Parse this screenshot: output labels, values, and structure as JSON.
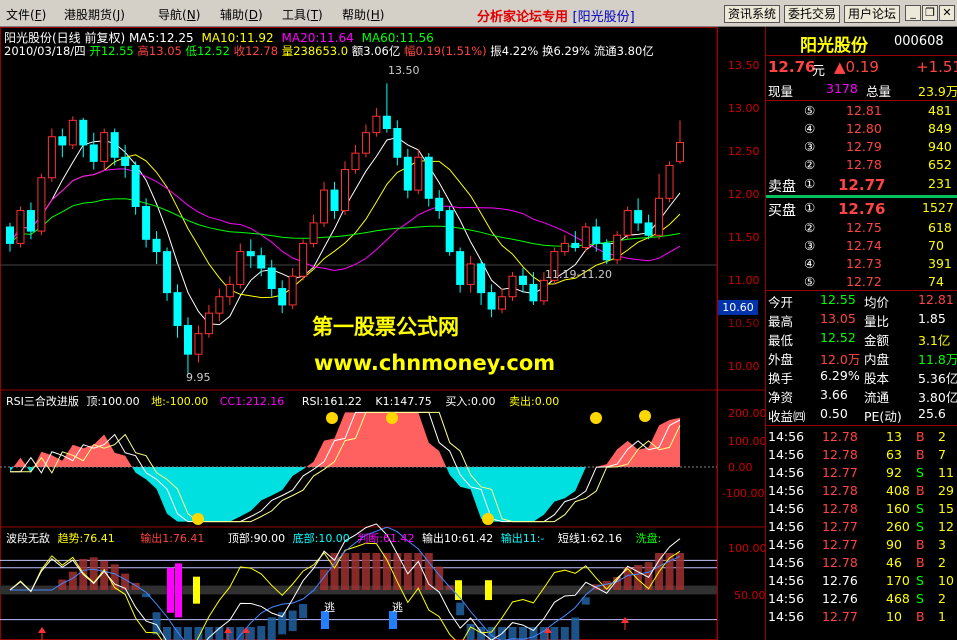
{
  "menubar": {
    "items": [
      {
        "label": "文件",
        "key": "F"
      },
      {
        "label": "港股期货",
        "key": "J"
      },
      {
        "label": "导航",
        "key": "N"
      },
      {
        "label": "辅助",
        "key": "D"
      },
      {
        "label": "工具",
        "key": "T"
      },
      {
        "label": "帮助",
        "key": "H"
      }
    ],
    "hint_prefix": "分析家论坛专用 ",
    "hint_stock": "[阳光股份]",
    "buttons": [
      "资讯系统",
      "委托交易",
      "用户论坛"
    ],
    "window_controls": [
      "_",
      "❐",
      "✕"
    ]
  },
  "kline": {
    "title_line1": [
      {
        "text": "阳光股份(日线 前复权)",
        "color": "#ffffff"
      },
      {
        "text": "MA5:12.25",
        "color": "#ffffff"
      },
      {
        "text": "MA10:11.92",
        "color": "#ffff00"
      },
      {
        "text": "MA20:11.64",
        "color": "#ff00ff"
      },
      {
        "text": "MA60:11.56",
        "color": "#00ff00"
      }
    ],
    "title_line2": [
      {
        "text": "2010/03/18/四",
        "color": "#ffffff"
      },
      {
        "text": "开12.55",
        "color": "#00ff00"
      },
      {
        "text": "高13.05",
        "color": "#ff4040"
      },
      {
        "text": "低12.52",
        "color": "#00ff00"
      },
      {
        "text": "收12.78",
        "color": "#ff4040"
      },
      {
        "text": "量238653.0",
        "color": "#ffff00"
      },
      {
        "text": "额3.06亿",
        "color": "#ffffff"
      },
      {
        "text": "幅0.19(1.51%)",
        "color": "#ff4040"
      },
      {
        "text": "振4.22%",
        "color": "#ffffff"
      },
      {
        "text": "换6.29%",
        "color": "#ffffff"
      },
      {
        "text": "流通3.80亿",
        "color": "#ffffff"
      }
    ],
    "y_axis": [
      "13.50",
      "13.00",
      "12.50",
      "12.00",
      "11.50",
      "11.00",
      "10.50",
      "10.00"
    ],
    "current_price_tag": "10.60",
    "annotations": {
      "high": "13.50",
      "low": "9.95",
      "range": "11.19-11.20"
    }
  },
  "watermark": {
    "line1": "第一股票公式网",
    "line2": "www.chnmoney.com"
  },
  "rsi": {
    "title": [
      {
        "text": "RSI三合改进版",
        "color": "#ffffff"
      },
      {
        "text": "顶:100.00",
        "color": "#ffffff"
      },
      {
        "text": "地:-100.00",
        "color": "#ffff00"
      },
      {
        "text": "CC1:212.16",
        "color": "#ff00ff"
      },
      {
        "text": "RSI:161.22",
        "color": "#ffffff"
      },
      {
        "text": "K1:147.75",
        "color": "#ffffff"
      },
      {
        "text": "买入:0.00",
        "color": "#ffffff"
      },
      {
        "text": "卖出:0.00",
        "color": "#ffff00"
      }
    ],
    "y_axis": [
      "200.00",
      "100.00",
      "0.00",
      "-100.00"
    ]
  },
  "wave": {
    "title": [
      {
        "text": "波段无敌",
        "color": "#ffffff"
      },
      {
        "text": "趋势:76.41",
        "color": "#ffff00"
      },
      {
        "text": "输出1:76.41",
        "color": "#ff4040"
      },
      {
        "text": "顶部:90.00",
        "color": "#ffffff"
      },
      {
        "text": "底部:10.00",
        "color": "#00ffff"
      },
      {
        "text": "判断:61.42",
        "color": "#ff00ff"
      },
      {
        "text": "输出10:61.42",
        "color": "#ffffff"
      },
      {
        "text": "输出11:-",
        "color": "#00ffff"
      },
      {
        "text": "短线1:62.16",
        "color": "#ffffff"
      },
      {
        "text": "洗盘:",
        "color": "#00ff00"
      }
    ],
    "y_axis": [
      "100.00",
      "50.00"
    ],
    "escape_label": "逃"
  },
  "side": {
    "name": "阳光股份",
    "code": "000608",
    "price": "12.76",
    "price_unit": "元",
    "change": "▲0.19",
    "pct": "+1.51",
    "xianliang_label": "现量",
    "xianliang": "3178",
    "zongliang_label": "总量",
    "zongliang": "23.9万",
    "asks": [
      [
        "⑤",
        "12.81",
        "481"
      ],
      [
        "④",
        "12.80",
        "849"
      ],
      [
        "③",
        "12.79",
        "940"
      ],
      [
        "②",
        "12.78",
        "652"
      ]
    ],
    "ask1": [
      "卖盘",
      "①",
      "12.77",
      "231"
    ],
    "bid1": [
      "买盘",
      "①",
      "12.76",
      "1527"
    ],
    "bids": [
      [
        "②",
        "12.75",
        "618"
      ],
      [
        "③",
        "12.74",
        "70"
      ],
      [
        "④",
        "12.73",
        "391"
      ],
      [
        "⑤",
        "12.72",
        "74"
      ]
    ],
    "stats": [
      [
        "今开",
        "12.55",
        "均价",
        "12.81"
      ],
      [
        "最高",
        "13.05",
        "量比",
        "1.85"
      ],
      [
        "最低",
        "12.52",
        "金额",
        "3.1亿"
      ],
      [
        "外盘",
        "12.0万",
        "内盘",
        "11.8万"
      ],
      [
        "换手",
        "6.29%",
        "股本",
        "5.36亿"
      ],
      [
        "净资",
        "3.66",
        "流通",
        "3.80亿"
      ],
      [
        "收益㈣",
        "0.50",
        "PE(动)",
        "25.6"
      ]
    ],
    "ticks": [
      [
        "14:56",
        "12.78",
        "13",
        "B",
        "2"
      ],
      [
        "14:56",
        "12.78",
        "63",
        "B",
        "7"
      ],
      [
        "14:56",
        "12.77",
        "92",
        "S",
        "11"
      ],
      [
        "14:56",
        "12.78",
        "408",
        "B",
        "29"
      ],
      [
        "14:56",
        "12.78",
        "160",
        "S",
        "15"
      ],
      [
        "14:56",
        "12.77",
        "260",
        "S",
        "12"
      ],
      [
        "14:56",
        "12.77",
        "90",
        "B",
        "3"
      ],
      [
        "14:56",
        "12.78",
        "46",
        "B",
        "2"
      ],
      [
        "14:56",
        "12.76",
        "170",
        "S",
        "10"
      ],
      [
        "14:56",
        "12.76",
        "468",
        "S",
        "2"
      ],
      [
        "14:56",
        "12.77",
        "10",
        "B",
        "1"
      ]
    ]
  },
  "chart_data": {
    "type": "candlestick",
    "y_range": [
      9.8,
      13.7
    ],
    "candles": [
      [
        11.75,
        11.55,
        11.8,
        11.45
      ],
      [
        11.55,
        11.95,
        12.0,
        11.5
      ],
      [
        11.95,
        11.7,
        12.05,
        11.6
      ],
      [
        11.7,
        12.35,
        12.4,
        11.65
      ],
      [
        12.35,
        12.85,
        12.95,
        12.3
      ],
      [
        12.85,
        12.75,
        12.95,
        12.6
      ],
      [
        12.75,
        13.05,
        13.1,
        12.7
      ],
      [
        13.05,
        12.75,
        13.08,
        12.6
      ],
      [
        12.75,
        12.55,
        12.9,
        12.45
      ],
      [
        12.55,
        12.9,
        12.95,
        12.45
      ],
      [
        12.9,
        12.6,
        12.95,
        12.5
      ],
      [
        12.6,
        12.5,
        12.75,
        12.35
      ],
      [
        12.5,
        12.0,
        12.55,
        11.9
      ],
      [
        12.0,
        11.6,
        12.1,
        11.5
      ],
      [
        11.6,
        11.45,
        11.7,
        11.3
      ],
      [
        11.45,
        10.95,
        11.5,
        10.85
      ],
      [
        10.95,
        10.55,
        11.05,
        10.4
      ],
      [
        10.55,
        10.2,
        10.65,
        9.95
      ],
      [
        10.2,
        10.45,
        10.55,
        10.1
      ],
      [
        10.45,
        10.7,
        10.8,
        10.4
      ],
      [
        10.7,
        10.9,
        11.0,
        10.6
      ],
      [
        10.9,
        11.05,
        11.15,
        10.8
      ],
      [
        11.05,
        11.45,
        11.55,
        11.0
      ],
      [
        11.45,
        11.4,
        11.6,
        11.25
      ],
      [
        11.4,
        11.25,
        11.5,
        11.15
      ],
      [
        11.25,
        11.0,
        11.35,
        10.9
      ],
      [
        11.0,
        10.8,
        11.1,
        10.7
      ],
      [
        10.8,
        11.15,
        11.25,
        10.75
      ],
      [
        11.15,
        11.55,
        11.6,
        11.1
      ],
      [
        11.55,
        11.8,
        11.9,
        11.5
      ],
      [
        11.8,
        12.2,
        12.3,
        11.75
      ],
      [
        12.2,
        11.95,
        12.3,
        11.85
      ],
      [
        11.95,
        12.45,
        12.55,
        11.9
      ],
      [
        12.45,
        12.65,
        12.75,
        12.4
      ],
      [
        12.65,
        12.9,
        13.0,
        12.6
      ],
      [
        12.9,
        13.1,
        13.2,
        12.85
      ],
      [
        13.1,
        12.95,
        13.5,
        12.9
      ],
      [
        12.95,
        12.6,
        13.05,
        12.5
      ],
      [
        12.6,
        12.2,
        12.7,
        12.1
      ],
      [
        12.2,
        12.6,
        12.7,
        12.15
      ],
      [
        12.6,
        12.1,
        12.65,
        12.0
      ],
      [
        12.1,
        11.95,
        12.2,
        11.85
      ],
      [
        11.95,
        11.45,
        12.0,
        11.4
      ],
      [
        11.45,
        11.05,
        11.5,
        10.95
      ],
      [
        11.05,
        11.3,
        11.4,
        10.95
      ],
      [
        11.3,
        10.95,
        11.35,
        10.8
      ],
      [
        10.95,
        10.75,
        11.05,
        10.65
      ],
      [
        10.75,
        10.9,
        11.0,
        10.7
      ],
      [
        10.9,
        11.15,
        11.2,
        10.85
      ],
      [
        11.15,
        11.05,
        11.25,
        10.95
      ],
      [
        11.05,
        10.85,
        11.2,
        10.8
      ],
      [
        10.85,
        11.1,
        11.2,
        10.8
      ],
      [
        11.1,
        11.45,
        11.5,
        11.05
      ],
      [
        11.45,
        11.55,
        11.65,
        11.4
      ],
      [
        11.55,
        11.5,
        11.7,
        11.45
      ],
      [
        11.5,
        11.75,
        11.8,
        11.45
      ],
      [
        11.75,
        11.55,
        11.85,
        11.45
      ],
      [
        11.55,
        11.35,
        11.6,
        11.3
      ],
      [
        11.35,
        11.65,
        11.7,
        11.3
      ],
      [
        11.65,
        11.95,
        12.0,
        11.6
      ],
      [
        11.95,
        11.8,
        12.1,
        11.7
      ],
      [
        11.8,
        11.65,
        11.9,
        11.6
      ],
      [
        11.65,
        12.1,
        12.4,
        11.6
      ],
      [
        12.1,
        12.5,
        12.55,
        12.05
      ],
      [
        12.55,
        12.78,
        13.05,
        12.52
      ]
    ]
  }
}
